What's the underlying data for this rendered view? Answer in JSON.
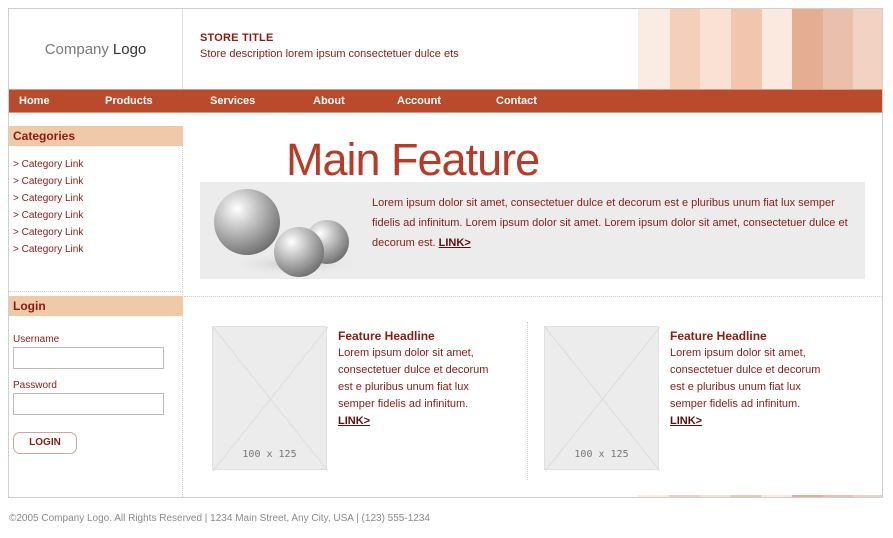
{
  "header": {
    "logo_prefix": "Company",
    "logo_bold": "Logo",
    "store_title": "STORE TITLE",
    "store_description": "Store description lorem ipsum consectetuer dulce ets",
    "stripe_colors": [
      "#fbece3",
      "#f4d0bb",
      "#f9e1d3",
      "#f2c6ae",
      "#fbe9df",
      "#e5ad92",
      "#eac0ad",
      "#f2d2c3"
    ]
  },
  "nav": {
    "items": [
      "Home",
      "Products",
      "Services",
      "About",
      "Account",
      "Contact"
    ],
    "color": "#b94a2b"
  },
  "sidebar": {
    "categories_heading": "Categories",
    "category_links": [
      "> Category Link",
      "> Category Link",
      "> Category Link",
      "> Category Link",
      "> Category Link",
      "> Category Link"
    ],
    "login_heading": "Login",
    "username_label": "Username",
    "password_label": "Password",
    "login_button": "LOGIN",
    "username_value": "",
    "password_value": ""
  },
  "main_feature": {
    "title": "Main Feature",
    "text": "Lorem ipsum dolor sit amet, consectetuer dulce et decorum est e pluribus unum fiat lux semper fidelis ad infinitum. Lorem ipsum dolor sit amet. Lorem ipsum dolor sit amet, consectetuer dulce et decorum est.",
    "link": "LINK>"
  },
  "features": [
    {
      "placeholder": "100 x 125",
      "headline": "Feature Headline",
      "lines": [
        "Lorem ipsum dolor sit amet,",
        "consectetuer dulce et decorum",
        "est e pluribus unum fiat lux",
        "semper fidelis ad infinitum."
      ],
      "link": "LINK>"
    },
    {
      "placeholder": "100 x 125",
      "headline": "Feature Headline",
      "lines": [
        "Lorem ipsum dolor sit amet,",
        "consectetuer dulce et decorum",
        "est e pluribus unum fiat lux",
        "semper fidelis ad infinitum."
      ],
      "link": "LINK>"
    }
  ],
  "footer": {
    "text": "©2005 Company Logo. All Rights Reserved | 1234 Main Street, Any City, USA | (123) 555-1234"
  }
}
